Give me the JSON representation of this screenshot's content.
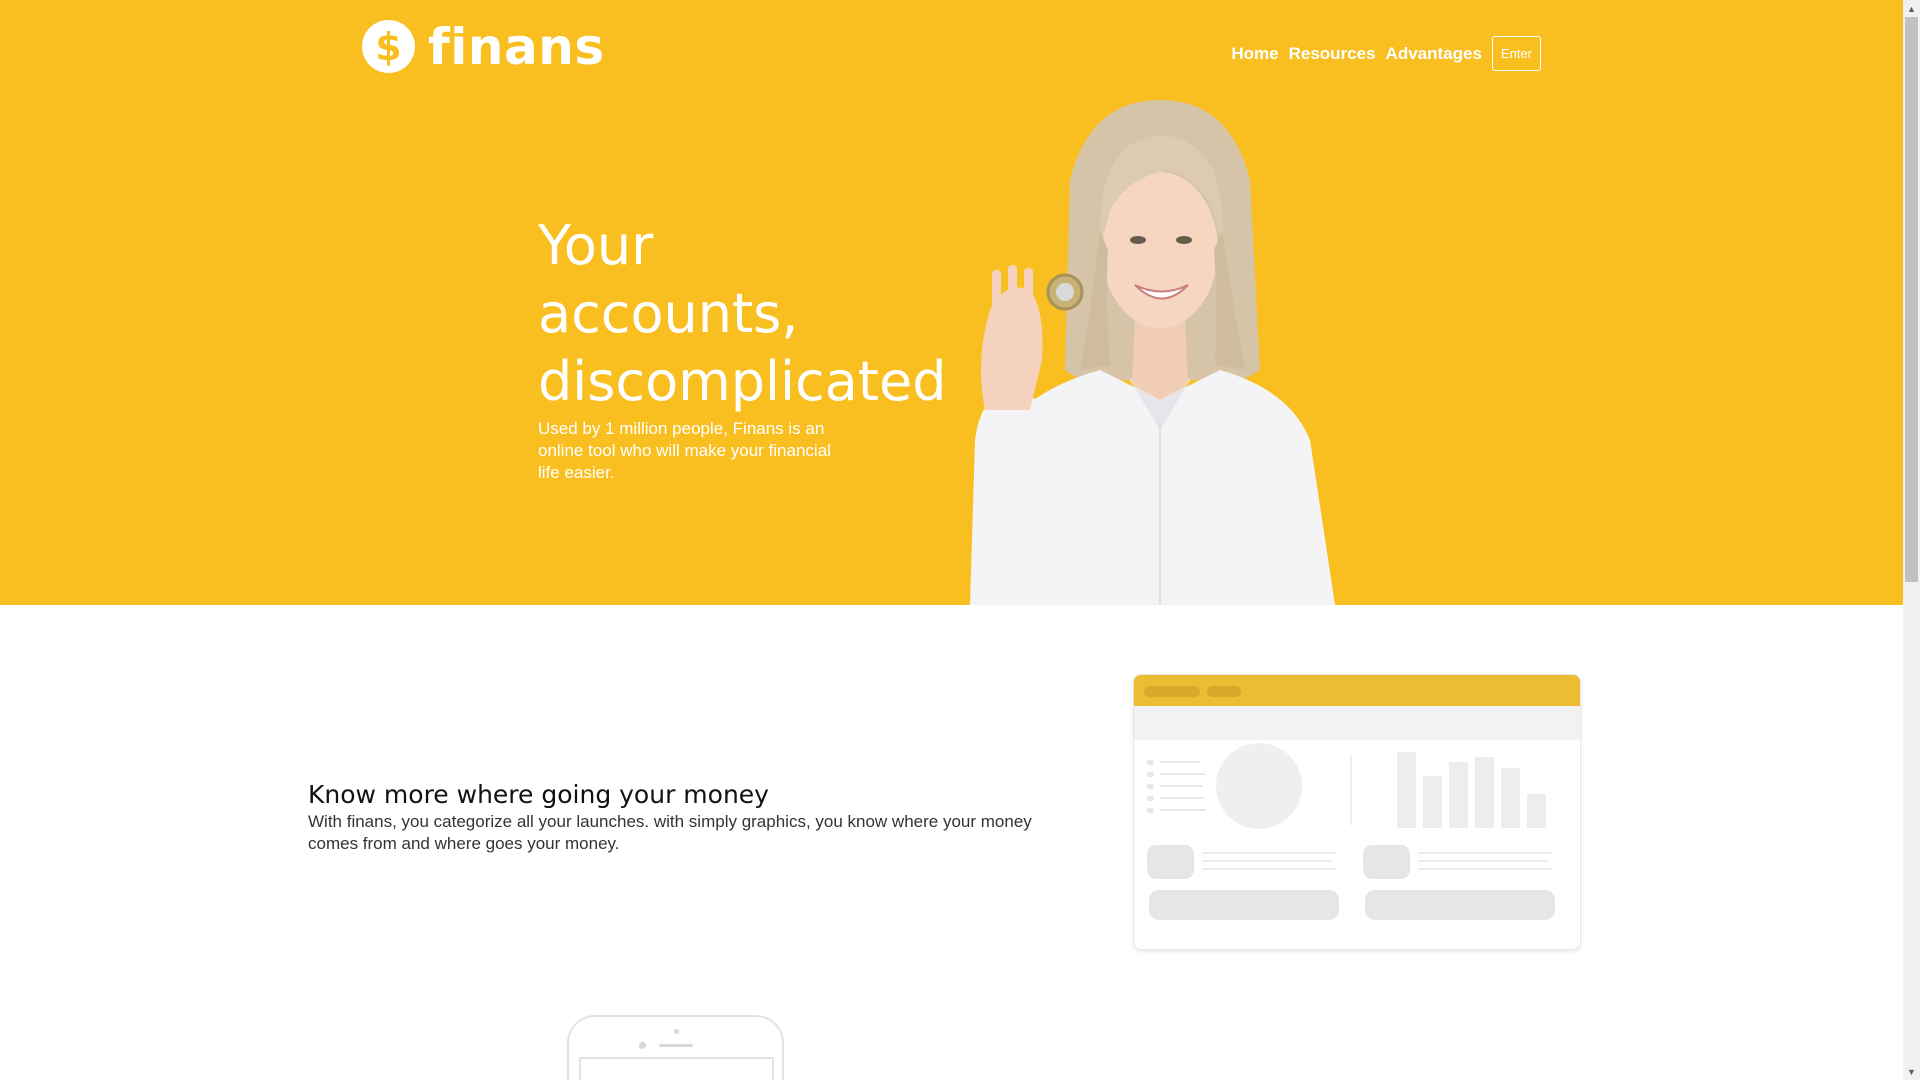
{
  "brand": {
    "logo_symbol": "$",
    "name": "finans"
  },
  "nav": {
    "items": [
      "Home",
      "Resources",
      "Advantages"
    ],
    "enter_label": "Enter"
  },
  "hero": {
    "title_line1": "Your",
    "title_line2": "accounts,",
    "title_line3": "discomplicated",
    "subtitle": "Used by 1 million people, Finans is an online tool who will make your financial life easier."
  },
  "feature": {
    "title": "Know more where going your money",
    "text": "With finans, you categorize all your launches. with simply graphics, you know where your money comes from and where goes your money."
  },
  "colors": {
    "brand_yellow": "#f9bf20",
    "card_header": "#ecbc33"
  },
  "icons": {
    "logo": "dollar-coin-icon",
    "woman": "woman-holding-coin-illustration",
    "dashboard": "dashboard-mockup-illustration",
    "phone": "phone-mockup-illustration"
  }
}
